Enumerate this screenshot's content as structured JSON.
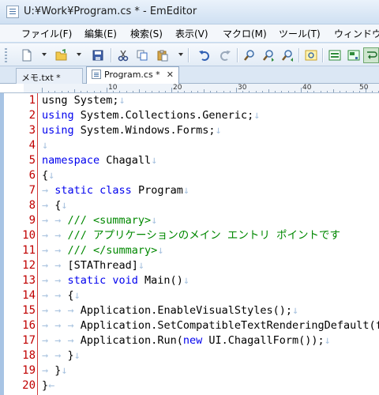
{
  "window": {
    "title": "U:¥Work¥Program.cs * - EmEditor"
  },
  "menu": [
    {
      "label": "ファイル(F)"
    },
    {
      "label": "編集(E)"
    },
    {
      "label": "検索(S)"
    },
    {
      "label": "表示(V)"
    },
    {
      "label": "マクロ(M)"
    },
    {
      "label": "ツール(T)"
    },
    {
      "label": "ウィンドウ"
    }
  ],
  "toolbar": {
    "icons": [
      "new-file-icon",
      "open-folder-icon",
      "save-icon",
      "cut-icon",
      "copy-icon",
      "paste-icon",
      "undo-icon",
      "redo-icon",
      "find-icon",
      "find-next-icon",
      "find-previous-icon",
      "highlight-icon",
      "view-mode-icon",
      "image-icon",
      "wrap-icon"
    ]
  },
  "tabs": [
    {
      "label": "メモ.txt *",
      "active": false
    },
    {
      "label": "Program.cs *",
      "active": true,
      "close": "✕"
    }
  ],
  "ruler": {
    "labels": [
      "10",
      "20",
      "30",
      "40",
      "50"
    ]
  },
  "editor": {
    "lines": [
      {
        "n": "1",
        "tokens": [
          {
            "t": "tx",
            "s": "usng System;"
          },
          {
            "t": "mk",
            "s": "↓"
          }
        ]
      },
      {
        "n": "2",
        "tokens": [
          {
            "t": "kw",
            "s": "using"
          },
          {
            "t": "tx",
            "s": " System.Collections.Generic;"
          },
          {
            "t": "mk",
            "s": "↓"
          }
        ]
      },
      {
        "n": "3",
        "tokens": [
          {
            "t": "kw",
            "s": "using"
          },
          {
            "t": "tx",
            "s": " System.Windows.Forms;"
          },
          {
            "t": "mk",
            "s": "↓"
          }
        ]
      },
      {
        "n": "4",
        "tokens": [
          {
            "t": "mk",
            "s": "↓"
          }
        ]
      },
      {
        "n": "5",
        "tokens": [
          {
            "t": "kw",
            "s": "namespace"
          },
          {
            "t": "tx",
            "s": " Chagall"
          },
          {
            "t": "mk",
            "s": "↓"
          }
        ]
      },
      {
        "n": "6",
        "tokens": [
          {
            "t": "tx",
            "s": "{"
          },
          {
            "t": "mk",
            "s": "↓"
          }
        ]
      },
      {
        "n": "7",
        "tokens": [
          {
            "t": "mk",
            "s": "→ "
          },
          {
            "t": "kw",
            "s": "static class"
          },
          {
            "t": "tx",
            "s": " Program"
          },
          {
            "t": "mk",
            "s": "↓"
          }
        ]
      },
      {
        "n": "8",
        "tokens": [
          {
            "t": "mk",
            "s": "→ "
          },
          {
            "t": "tx",
            "s": "{"
          },
          {
            "t": "mk",
            "s": "↓"
          }
        ]
      },
      {
        "n": "9",
        "tokens": [
          {
            "t": "mk",
            "s": "→ → "
          },
          {
            "t": "cm",
            "s": "/// <summary>"
          },
          {
            "t": "mk",
            "s": "↓"
          }
        ]
      },
      {
        "n": "10",
        "tokens": [
          {
            "t": "mk",
            "s": "→ → "
          },
          {
            "t": "cm",
            "s": "/// アプリケーションのメイン エントリ ポイントです"
          }
        ]
      },
      {
        "n": "11",
        "tokens": [
          {
            "t": "mk",
            "s": "→ → "
          },
          {
            "t": "cm",
            "s": "/// </summary>"
          },
          {
            "t": "mk",
            "s": "↓"
          }
        ]
      },
      {
        "n": "12",
        "tokens": [
          {
            "t": "mk",
            "s": "→ → "
          },
          {
            "t": "tx",
            "s": "[STAThread]"
          },
          {
            "t": "mk",
            "s": "↓"
          }
        ]
      },
      {
        "n": "13",
        "tokens": [
          {
            "t": "mk",
            "s": "→ → "
          },
          {
            "t": "kw",
            "s": "static void"
          },
          {
            "t": "tx",
            "s": " Main()"
          },
          {
            "t": "mk",
            "s": "↓"
          }
        ]
      },
      {
        "n": "14",
        "tokens": [
          {
            "t": "mk",
            "s": "→ → "
          },
          {
            "t": "tx",
            "s": "{"
          },
          {
            "t": "mk",
            "s": "↓"
          }
        ]
      },
      {
        "n": "15",
        "tokens": [
          {
            "t": "mk",
            "s": "→ → → "
          },
          {
            "t": "tx",
            "s": "Application.EnableVisualStyles();"
          },
          {
            "t": "mk",
            "s": "↓"
          }
        ]
      },
      {
        "n": "16",
        "tokens": [
          {
            "t": "mk",
            "s": "→ → → "
          },
          {
            "t": "tx",
            "s": "Application.SetCompatibleTextRenderingDefault(fa"
          }
        ]
      },
      {
        "n": "17",
        "tokens": [
          {
            "t": "mk",
            "s": "→ → → "
          },
          {
            "t": "tx",
            "s": "Application.Run("
          },
          {
            "t": "kw",
            "s": "new"
          },
          {
            "t": "tx",
            "s": " UI.ChagallForm());"
          },
          {
            "t": "mk",
            "s": "↓"
          }
        ]
      },
      {
        "n": "18",
        "tokens": [
          {
            "t": "mk",
            "s": "→ → "
          },
          {
            "t": "tx",
            "s": "}"
          },
          {
            "t": "mk",
            "s": "↓"
          }
        ]
      },
      {
        "n": "19",
        "tokens": [
          {
            "t": "mk",
            "s": "→ "
          },
          {
            "t": "tx",
            "s": "}"
          },
          {
            "t": "mk",
            "s": "↓"
          }
        ]
      },
      {
        "n": "20",
        "tokens": [
          {
            "t": "tx",
            "s": "}"
          },
          {
            "t": "mk",
            "s": "←"
          }
        ]
      }
    ]
  },
  "colors": {
    "keyword": "#0000ee",
    "comment": "#008800",
    "line_number": "#c00000",
    "marker": "#aac4e0"
  }
}
